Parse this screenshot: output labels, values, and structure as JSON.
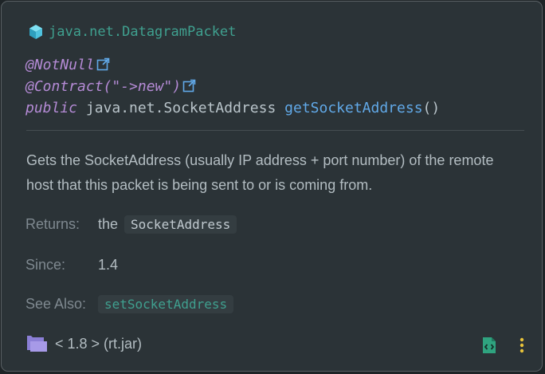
{
  "header": {
    "class_name": "java.net.DatagramPacket",
    "icon": "cube-icon"
  },
  "signature": {
    "annotation1": "@NotNull",
    "annotation2_name": "@Contract(",
    "annotation2_arg": "\"->new\"",
    "annotation2_close": ")",
    "modifier": "public",
    "return_type": "java.net.SocketAddress",
    "method_name": "getSocketAddress",
    "params": "()"
  },
  "description": "Gets the SocketAddress (usually IP address + port number) of the remote host that this packet is being sent to or is coming from.",
  "returns": {
    "label": "Returns:",
    "prefix": "the",
    "code": "SocketAddress"
  },
  "since": {
    "label": "Since:",
    "value": "1.4"
  },
  "see_also": {
    "label": "See Also:",
    "link": "setSocketAddress"
  },
  "footer": {
    "library": "< 1.8 > (rt.jar)",
    "icons": [
      "folder-icon",
      "view-source-icon",
      "more-vertical-icon"
    ]
  },
  "colors": {
    "background": "#2b3337",
    "accent": "#3fa08f",
    "annotation": "#b58bd6",
    "method": "#61a9e8"
  }
}
